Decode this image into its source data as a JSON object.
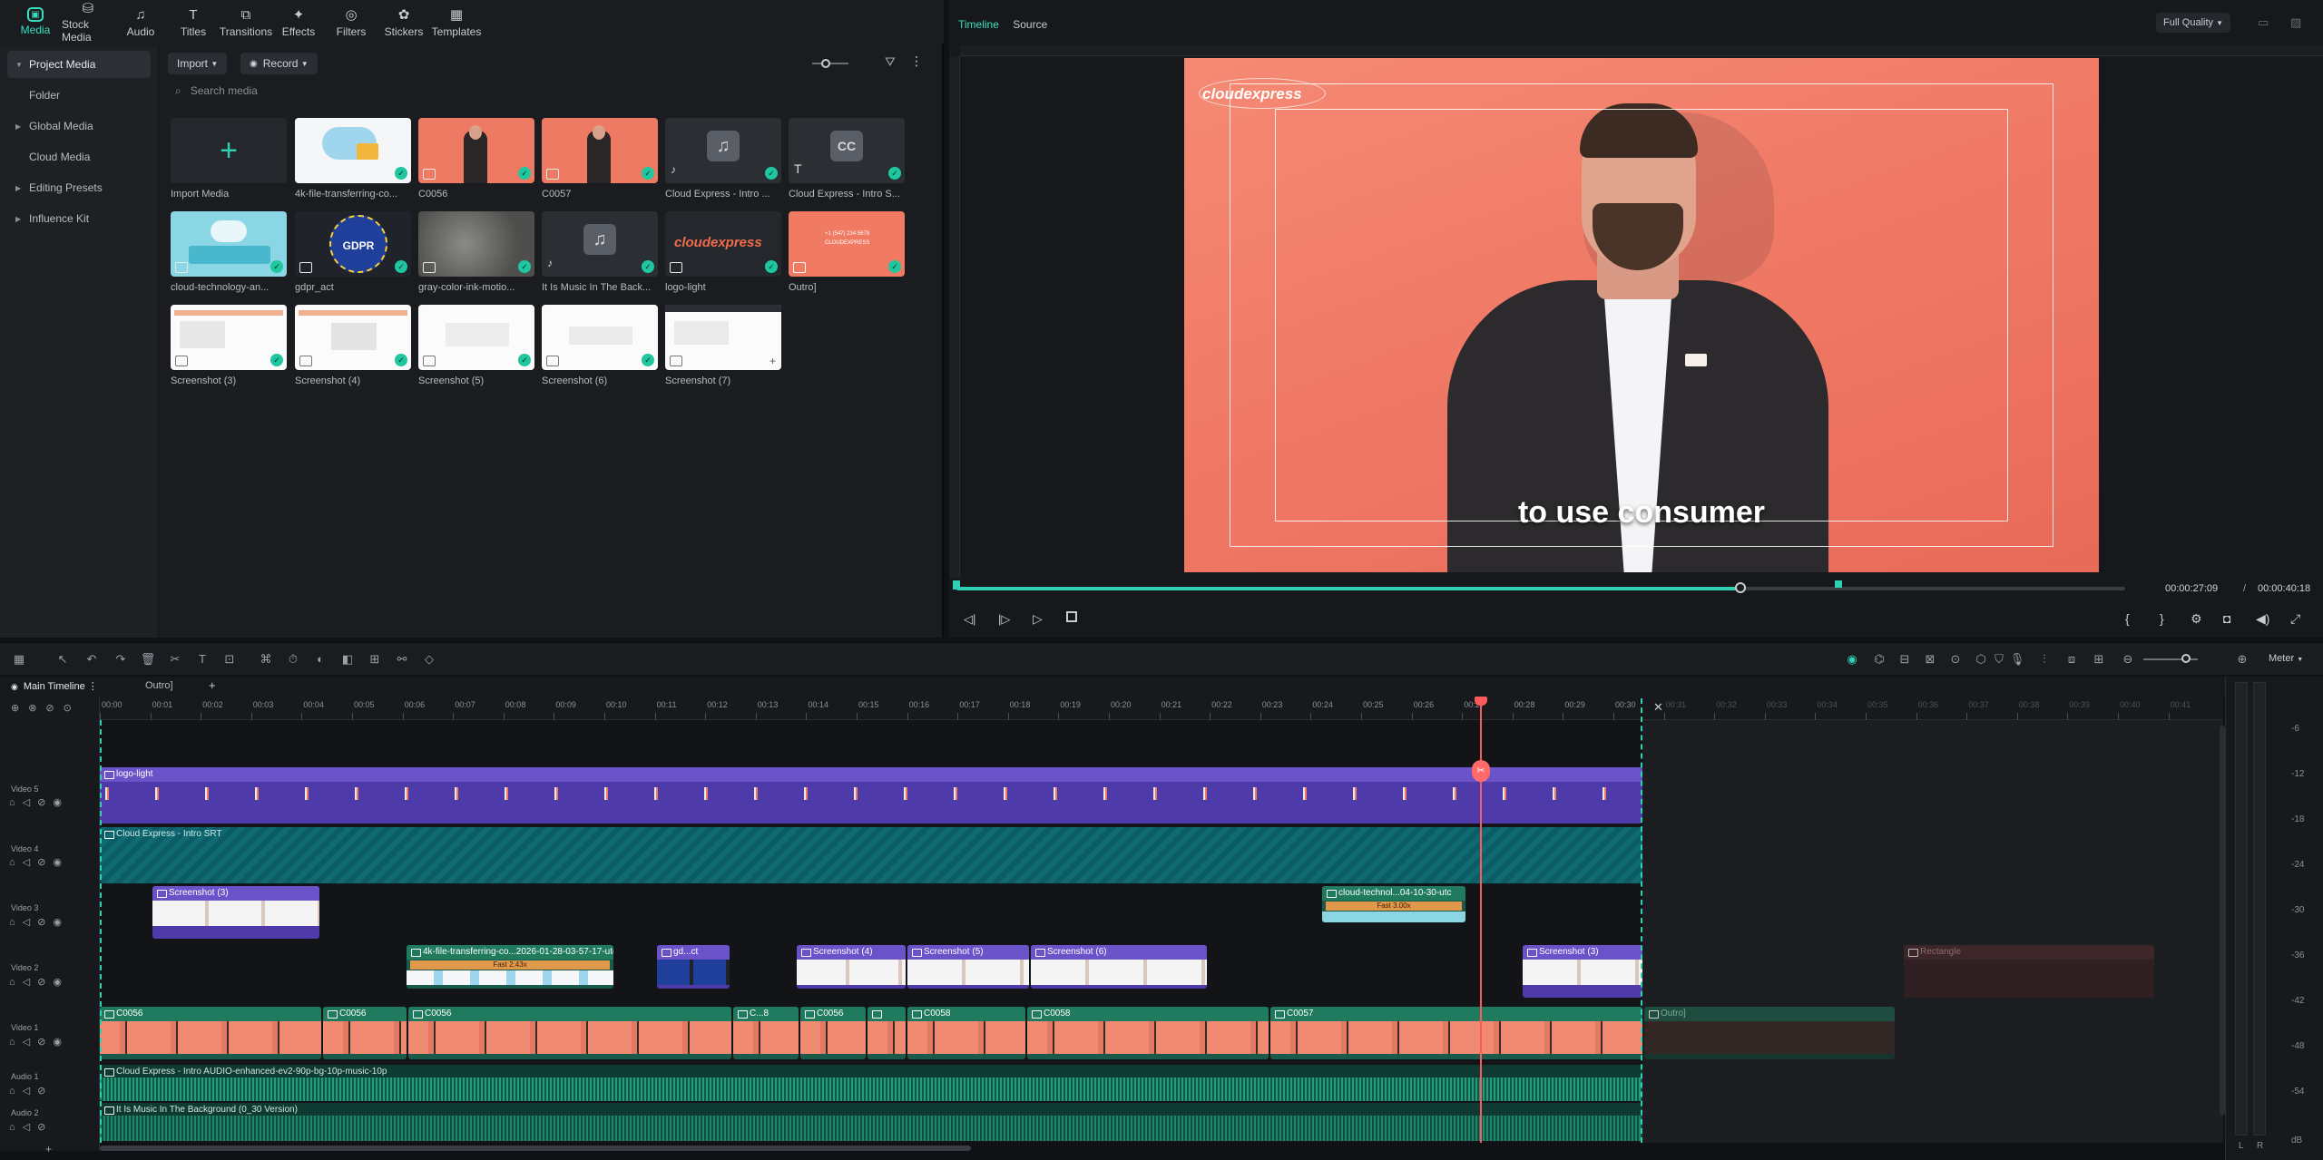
{
  "top_tabs": [
    {
      "label": "Media",
      "icon": "media-icon"
    },
    {
      "label": "Stock Media",
      "icon": "stock-media-icon"
    },
    {
      "label": "Audio",
      "icon": "audio-icon"
    },
    {
      "label": "Titles",
      "icon": "titles-icon"
    },
    {
      "label": "Transitions",
      "icon": "transitions-icon"
    },
    {
      "label": "Effects",
      "icon": "effects-icon"
    },
    {
      "label": "Filters",
      "icon": "filters-icon"
    },
    {
      "label": "Stickers",
      "icon": "stickers-icon"
    },
    {
      "label": "Templates",
      "icon": "templates-icon"
    }
  ],
  "sidebar": {
    "items": [
      {
        "label": "Project Media",
        "active": true
      },
      {
        "label": "Folder",
        "sub": true
      },
      {
        "label": "Global Media"
      },
      {
        "label": "Cloud Media",
        "sub": true
      },
      {
        "label": "Editing Presets"
      },
      {
        "label": "Influence Kit"
      }
    ]
  },
  "media_toolbar": {
    "import": "Import",
    "record": "Record"
  },
  "search": {
    "placeholder": "Search media"
  },
  "media_items": [
    {
      "label": "Import Media",
      "type": "import"
    },
    {
      "label": "4k-file-transferring-co...",
      "type": "image"
    },
    {
      "label": "C0056",
      "type": "video"
    },
    {
      "label": "C0057",
      "type": "video"
    },
    {
      "label": "Cloud Express - Intro ...",
      "type": "audio"
    },
    {
      "label": "Cloud Express - Intro S...",
      "type": "subtitle"
    },
    {
      "label": "cloud-technology-an...",
      "type": "video"
    },
    {
      "label": "gdpr_act",
      "type": "image"
    },
    {
      "label": "gray-color-ink-motio...",
      "type": "video"
    },
    {
      "label": "It Is Music In The Back...",
      "type": "audio"
    },
    {
      "label": "logo-light",
      "type": "image"
    },
    {
      "label": "Outro]",
      "type": "project"
    },
    {
      "label": "Screenshot (3)",
      "type": "image"
    },
    {
      "label": "Screenshot (4)",
      "type": "image"
    },
    {
      "label": "Screenshot (5)",
      "type": "image"
    },
    {
      "label": "Screenshot (6)",
      "type": "image"
    },
    {
      "label": "Screenshot (7)",
      "type": "image"
    }
  ],
  "gdpr_badge": "GDPR",
  "cc_badge": "CC",
  "logo_text": "cloudexpress",
  "outro_text": {
    "line1": "+1 (547) 234 5678",
    "line2": "CLOUDEXPRESS"
  },
  "preview": {
    "tab_timeline": "Timeline",
    "tab_source": "Source",
    "quality": "Full Quality",
    "subtitle": "to use consumer",
    "current_time": "00:00:27:09",
    "separator": "/",
    "total_time": "00:00:40:18",
    "progress_fraction": 0.672,
    "watermark": "cloudexpress"
  },
  "timeline": {
    "tabs": [
      "Main Timeline",
      "Outro]"
    ],
    "ruler": [
      "00:00",
      "00:01",
      "00:02",
      "00:03",
      "00:04",
      "00:05",
      "00:06",
      "00:07",
      "00:08",
      "00:09",
      "00:10",
      "00:11",
      "00:12",
      "00:13",
      "00:14",
      "00:15",
      "00:16",
      "00:17",
      "00:18",
      "00:19",
      "00:20",
      "00:21",
      "00:22",
      "00:23",
      "00:24",
      "00:25",
      "00:26",
      "00:27",
      "00:28",
      "00:29",
      "00:30",
      "00:31",
      "00:32",
      "00:33",
      "00:34",
      "00:35",
      "00:36",
      "00:37",
      "00:38",
      "00:39",
      "00:40",
      "00:41"
    ],
    "tracks": [
      "Video 5",
      "Video 4",
      "Video 3",
      "Video 2",
      "Video 1",
      "Audio 1",
      "Audio 2"
    ],
    "clips": {
      "v5": "logo-light",
      "v4": "Cloud Express - Intro SRT",
      "v3a": "Screenshot (3)",
      "v3b": "cloud-technol...04-10-30-utc",
      "v3b_speed": "Fast 3.00x",
      "v2a": "4k-file-transferring-co...2026-01-28-03-57-17-utc",
      "v2a_speed": "Fast 2.43x",
      "v2b": "gd...ct",
      "v2c": "Screenshot (4)",
      "v2d": "Screenshot (5)",
      "v2e": "Screenshot (6)",
      "v2f": "Screenshot (3)",
      "v2g": "Rectangle",
      "v1": [
        "C0056",
        "C0056",
        "C0056",
        "C...8",
        "C0056",
        "",
        "C0058",
        "C0058",
        "C0057",
        "Outro]"
      ],
      "a1": "Cloud Express - Intro AUDIO-enhanced-ev2-90p-bg-10p-music-10p",
      "a2": "It Is Music In The Background (0_30 Version)"
    },
    "meter_label": "Meter",
    "db_scale": [
      "-6",
      "-12",
      "-18",
      "-24",
      "-30",
      "-36",
      "-42",
      "-48",
      "-54",
      "dB"
    ],
    "lr": [
      "L",
      "R"
    ]
  }
}
